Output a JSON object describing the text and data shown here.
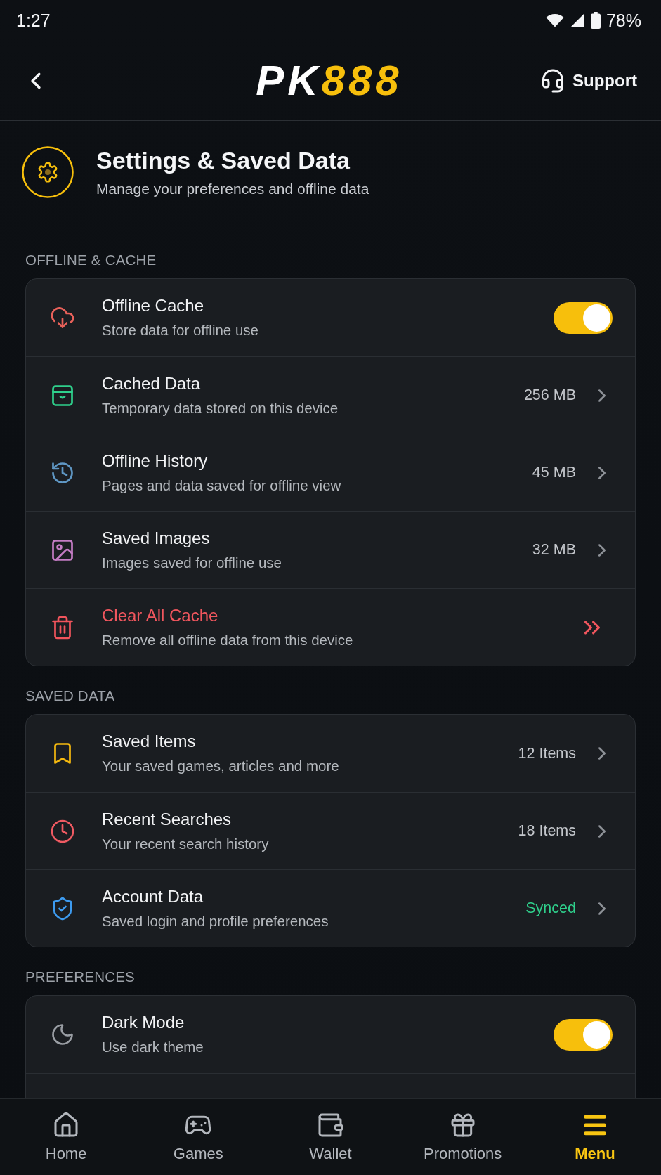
{
  "status_bar": {
    "time": "1:27",
    "battery": "78%"
  },
  "header": {
    "logo": {
      "text": "PK",
      "accent": "888"
    },
    "support": "Support"
  },
  "page_title": {
    "title": "Settings & Saved Data",
    "subtitle": "Manage your preferences and offline data"
  },
  "sections": [
    {
      "title": "OFFLINE & CACHE",
      "rows": [
        {
          "kind": "toggle",
          "title": "Offline Cache",
          "subtitle": "Store data for offline use",
          "on": true,
          "color": "#e8615a"
        },
        {
          "kind": "value",
          "title": "Cached Data",
          "subtitle": "Temporary data stored on this device",
          "value": "256 MB",
          "color": "#2fd08c"
        },
        {
          "kind": "value",
          "title": "Offline History",
          "subtitle": "Pages and data saved for offline view",
          "value": "45 MB",
          "color": "#5f97c4"
        },
        {
          "kind": "value",
          "title": "Saved Images",
          "subtitle": "Images saved for offline use",
          "value": "32 MB",
          "color": "#c47cc4"
        },
        {
          "kind": "danger",
          "title": "Clear All Cache",
          "subtitle": "Remove all offline data from this device",
          "color": "#f0545c"
        }
      ]
    },
    {
      "title": "SAVED DATA",
      "rows": [
        {
          "kind": "value",
          "title": "Saved Items",
          "subtitle": "Your saved games, articles and more",
          "value": "12 Items",
          "color": "#f5b90f"
        },
        {
          "kind": "value",
          "title": "Recent Searches",
          "subtitle": "Your recent search history",
          "value": "18 Items",
          "color": "#ef5a62"
        },
        {
          "kind": "status",
          "title": "Account Data",
          "subtitle": "Saved login and profile preferences",
          "value": "Synced",
          "color": "#3d9bf0"
        }
      ]
    },
    {
      "title": "PREFERENCES",
      "rows": [
        {
          "kind": "toggle",
          "title": "Dark Mode",
          "subtitle": "Use dark theme",
          "on": true,
          "color": "#9a9ea4"
        }
      ]
    }
  ],
  "bottom_nav": [
    {
      "label": "Home",
      "selected": false
    },
    {
      "label": "Games",
      "selected": false
    },
    {
      "label": "Wallet",
      "selected": false
    },
    {
      "label": "Promotions",
      "selected": false
    },
    {
      "label": "Menu",
      "selected": true
    }
  ]
}
